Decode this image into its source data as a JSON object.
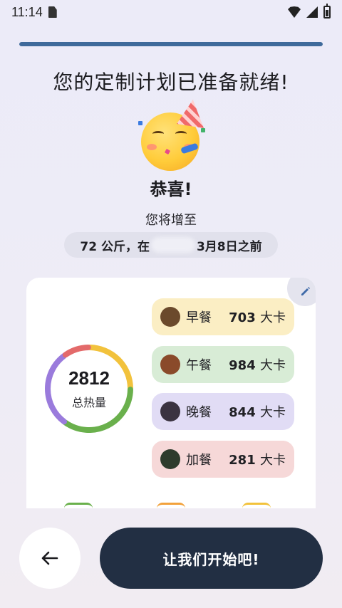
{
  "status_bar": {
    "time": "11:14"
  },
  "progress": {
    "fraction": 1.0,
    "color": "#3f6a9b"
  },
  "headline": "您的定制计划已准备就绪!",
  "congrats": "恭喜!",
  "subtitle": "您将增至",
  "target": {
    "prefix": "72 公斤，在",
    "suffix": "3月8日之前"
  },
  "summary": {
    "total": "2812",
    "total_label": "总热量",
    "meals": [
      {
        "name": "早餐",
        "kcal": "703",
        "unit": "大卡",
        "bg": "#fbeec4",
        "color": "#f2c23c",
        "icon": "breakfast-icon",
        "value": 703
      },
      {
        "name": "午餐",
        "kcal": "984",
        "unit": "大卡",
        "bg": "#d8ecd6",
        "color": "#6ab04c",
        "icon": "lunch-icon",
        "value": 984
      },
      {
        "name": "晚餐",
        "kcal": "844",
        "unit": "大卡",
        "bg": "#e1dcf5",
        "color": "#9a7bdc",
        "icon": "dinner-icon",
        "value": 844
      },
      {
        "name": "加餐",
        "kcal": "281",
        "unit": "大卡",
        "bg": "#f6d8d8",
        "color": "#e36a6a",
        "icon": "snack-icon",
        "value": 281
      }
    ]
  },
  "actions": {
    "back_icon": "arrow-left-icon",
    "start_label": "让我们开始吧!"
  }
}
